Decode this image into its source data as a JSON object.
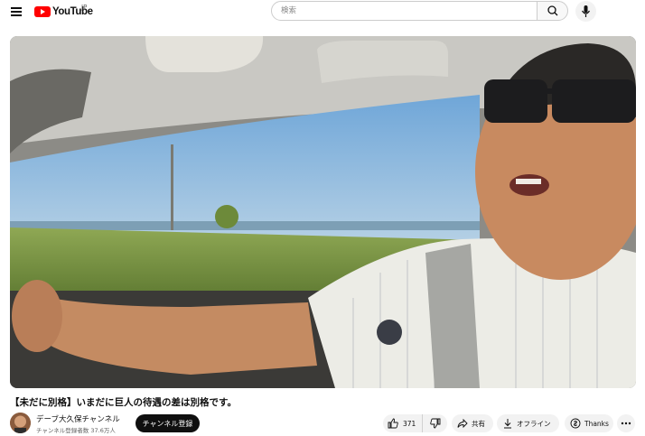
{
  "header": {
    "logo_text": "YouTube",
    "logo_superscript": "JP",
    "search_placeholder": "検索",
    "icons": [
      "menu-icon",
      "search-icon",
      "mic-icon"
    ]
  },
  "video": {
    "title": "【未だに別格】いまだに巨人の待遇の差は別格です。"
  },
  "channel": {
    "name": "デーブ大久保チャンネル",
    "subscribers": "チャンネル登録者数 37.6万人",
    "subscribe_label": "チャンネル登録"
  },
  "actions": {
    "like_count": "371",
    "share_label": "共有",
    "download_label": "オフライン",
    "thanks_label": "Thanks"
  },
  "colors": {
    "brand_red": "#ff0000",
    "subscribe_bg": "#0f0f0f",
    "pill_bg": "#f2f2f2"
  }
}
